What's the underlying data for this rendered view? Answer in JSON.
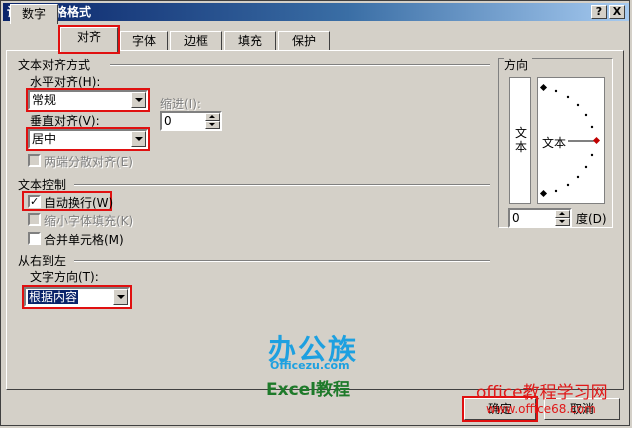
{
  "window": {
    "title": "设置单元格格式",
    "help_button": "?",
    "close_button": "X"
  },
  "tabs": [
    "数字",
    "对齐",
    "字体",
    "边框",
    "填充",
    "保护"
  ],
  "active_tab": "对齐",
  "text_alignment": {
    "group_label": "文本对齐方式",
    "horizontal_label": "水平对齐(H):",
    "horizontal_value": "常规",
    "indent_label": "缩进(I):",
    "indent_value": "0",
    "vertical_label": "垂直对齐(V):",
    "vertical_value": "居中",
    "justify_distributed_label": "两端分散对齐(E)"
  },
  "text_control": {
    "group_label": "文本控制",
    "wrap_text": {
      "label": "自动换行(W)",
      "checked": true
    },
    "shrink_to_fit": {
      "label": "缩小字体填充(K)",
      "checked": false,
      "enabled": false
    },
    "merge_cells": {
      "label": "合并单元格(M)",
      "checked": false
    }
  },
  "rtl": {
    "group_label": "从右到左",
    "direction_label": "文字方向(T):",
    "direction_value": "根据内容"
  },
  "orientation": {
    "group_label": "方向",
    "vertical_text": "文本",
    "dial_text": "文本",
    "degrees_value": "0",
    "degrees_label": "度(D)"
  },
  "buttons": {
    "ok": "确定",
    "cancel": "取消"
  },
  "watermarks": {
    "logo": "办公族",
    "site": "Officezu.com",
    "excel": "Excel教程",
    "red_title": "office教程学习网",
    "red_url": "www.office68.com"
  },
  "colors": {
    "highlight": "#e01010",
    "title_bar": "#0a246a",
    "selection": "#0a246a"
  }
}
